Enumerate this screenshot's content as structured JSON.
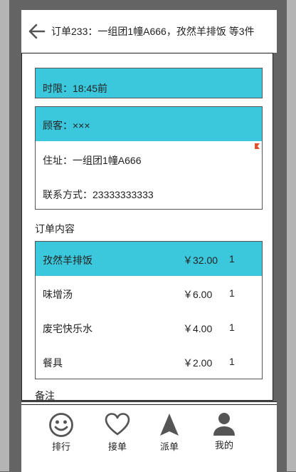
{
  "header": {
    "title": "订单233：一组团1幢A666，孜然羊排饭 等3件"
  },
  "deadline": {
    "text": "时限：18:45前"
  },
  "customer": {
    "name": "顾客：×××",
    "address": "住址：一组团1幢A666",
    "contact": "联系方式：23333333333"
  },
  "order": {
    "section_title": "订单内容",
    "items": [
      {
        "name": "孜然羊排饭",
        "price": "￥32.00",
        "qty": "1"
      },
      {
        "name": "味增汤",
        "price": "￥6.00",
        "qty": "1"
      },
      {
        "name": "废宅快乐水",
        "price": "￥4.00",
        "qty": "1"
      },
      {
        "name": "餐具",
        "price": "￥2.00",
        "qty": "1"
      }
    ]
  },
  "remarks": {
    "title": "备注"
  },
  "tabs": [
    {
      "label": "排行",
      "icon": "smiley-icon"
    },
    {
      "label": "接单",
      "icon": "heart-icon"
    },
    {
      "label": "派单",
      "icon": "navigation-arrow-icon"
    },
    {
      "label": "我的",
      "icon": "user-icon"
    }
  ],
  "colors": {
    "accent": "#3cc8dc",
    "frame": "#646464",
    "side": "#b4b4b4"
  }
}
